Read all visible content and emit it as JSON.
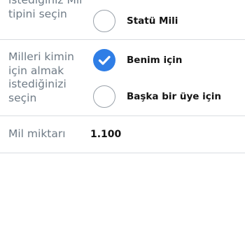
{
  "mile_type": {
    "label_lines": [
      "istediğiniz Mil",
      "tipini seçin"
    ],
    "options": [
      {
        "label": "Statü Mili",
        "selected": false
      }
    ]
  },
  "recipient": {
    "label_lines": [
      "Milleri kimin",
      "için almak",
      "istediğinizi",
      "seçin"
    ],
    "options": [
      {
        "label": "Benim için",
        "selected": true
      },
      {
        "label": "Başka bir üye için",
        "selected": false
      }
    ]
  },
  "miles": {
    "label": "Mil miktarı",
    "value": "1.100"
  },
  "colors": {
    "accent": "#2f7ee6",
    "label_text": "#6f7b86",
    "divider": "#d9dde1"
  }
}
